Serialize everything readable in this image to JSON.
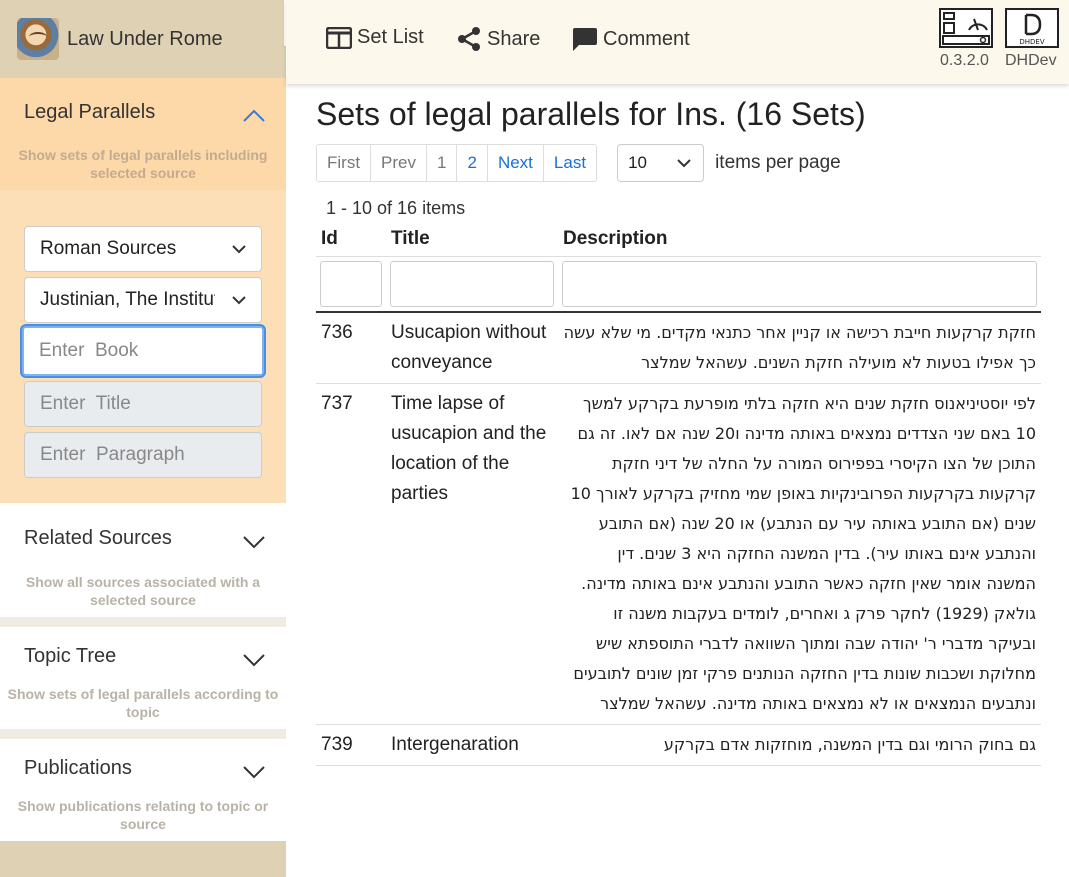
{
  "brand": {
    "name": "Law Under Rome"
  },
  "sidebar": {
    "legal_parallels": {
      "title": "Legal Parallels",
      "description": "Show sets of legal parallels including selected source"
    },
    "filters": {
      "source_select": "Roman Sources",
      "work_select": "Justinian, The Institutes",
      "book_placeholder": "Enter  Book",
      "title_placeholder": "Enter  Title",
      "paragraph_placeholder": "Enter  Paragraph"
    },
    "related_sources": {
      "title": "Related Sources",
      "description": "Show all sources associated with a selected source"
    },
    "topic_tree": {
      "title": "Topic Tree",
      "description": "Show sets of legal parallels according to topic"
    },
    "publications": {
      "title": "Publications",
      "description": "Show publications relating to topic or source"
    }
  },
  "toolbar": {
    "set_list": "Set List",
    "share": "Share",
    "comment": "Comment",
    "version": "0.3.2.0",
    "dev": "DHDev",
    "dev_logo_text": "DHDEV"
  },
  "main": {
    "title": "Sets of legal parallels for Ins.  (16 Sets)",
    "pager": {
      "first": "First",
      "prev": "Prev",
      "p1": "1",
      "p2": "2",
      "next": "Next",
      "last": "Last"
    },
    "per_page": "10",
    "per_page_label": "items per page",
    "count": "1 - 10 of 16 items",
    "columns": {
      "id": "Id",
      "title": "Title",
      "description": "Description"
    },
    "rows": [
      {
        "id": "736",
        "title": "Usucapion without conveyance",
        "description": "חזקת קרקעות חייבת רכישה או קניין אחר כתנאי מקדים. מי שלא עשה כך אפילו בטעות לא מועילה חזקת השנים. עשהאל שמלצר"
      },
      {
        "id": "737",
        "title": "Time lapse of usucapion and the location of the parties",
        "description": "לפי יוסטיניאנוס חזקת שנים היא חזקה בלתי מופרעת בקרקע למשך 10 באם שני הצדדים נמצאים באותה מדינה ו20 שנה אם לאו. זה גם התוכן של הצו הקיסרי בפפירוס המורה על החלה של דיני חזקת קרקעות בקרקעות הפרובינקיות באופן שמי מחזיק בקרקע לאורך 10 שנים (אם התובע באותה עיר עם הנתבע) או 20 שנה (אם התובע והנתבע אינם באותו עיר). בדין המשנה החזקה היא 3 שנים. דין המשנה אומר שאין חזקה כאשר התובע והנתבע אינם באותה מדינה. גולאק (1929) לחקר פרק ג ואחרים, לומדים בעקבות משנה זו ובעיקר מדברי ר' יהודה שבה ומתוך השוואה לדברי התוספתא שיש מחלוקת ושכבות שונות בדין החזקה הנותנים פרקי זמן שונים לתובעים ונתבעים הנמצאים או לא נמצאים באותה מדינה. עשהאל שמלצר"
      },
      {
        "id": "739",
        "title": "Intergenaration",
        "description": "גם בחוק הרומי וגם בדין המשנה, מוחזקות אדם בקרקע"
      }
    ]
  }
}
